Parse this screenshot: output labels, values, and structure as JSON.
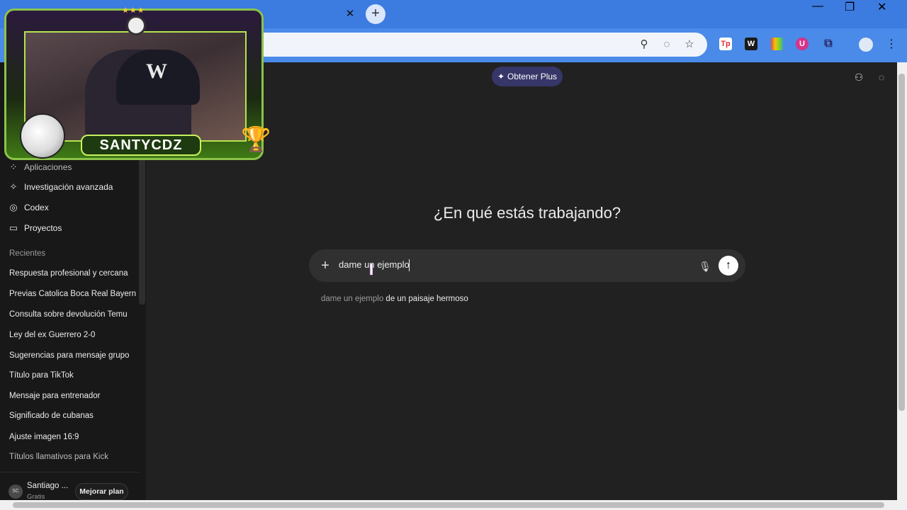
{
  "browser": {
    "window_controls": {
      "minimize": "—",
      "restore": "❐",
      "close": "✕"
    },
    "tab_close": "✕",
    "new_tab": "+",
    "omnibox_icons": [
      "zoom-icon",
      "eye-off-icon",
      "star-icon"
    ],
    "extensions": [
      {
        "name": "tp-extension-icon",
        "label": "Tp",
        "color": "#e0313a"
      },
      {
        "name": "w-extension-icon",
        "label": "W",
        "color": "#1a1a1a"
      },
      {
        "name": "color-extension-icon",
        "label": "",
        "color": "#7ed321"
      },
      {
        "name": "u-extension-icon",
        "label": "U",
        "color": "#d6338a"
      },
      {
        "name": "puzzle-extension-icon",
        "label": "",
        "color": "#2a5bd7"
      }
    ]
  },
  "sidebar": {
    "nav": [
      {
        "icon": "apps-icon",
        "glyph": "⁘",
        "label": "Aplicaciones"
      },
      {
        "icon": "telescope-icon",
        "glyph": "✧",
        "label": "Investigación avanzada"
      },
      {
        "icon": "codex-icon",
        "glyph": "◎",
        "label": "Codex"
      },
      {
        "icon": "folder-icon",
        "glyph": "▭",
        "label": "Proyectos"
      }
    ],
    "recent_title": "Recientes",
    "recent": [
      "Respuesta profesional y cercana",
      "Previas Catolica Boca Real Bayern",
      "Consulta sobre devolución Temu",
      "Ley del ex Guerrero 2-0",
      "Sugerencias para mensaje grupo",
      "Título para TikTok",
      "Mensaje para entrenador",
      "Significado de cubanas",
      "Ajuste imagen 16:9",
      "Títulos llamativos para Kick"
    ],
    "user": {
      "initials": "SC",
      "name": "Santiago ...",
      "plan": "Gratis",
      "upgrade": "Mejorar plan"
    }
  },
  "main": {
    "plus_button": "Obtener Plus",
    "plus_icon": "✦",
    "heading": "¿En qué estás trabajando?",
    "composer": {
      "attach": "+",
      "value": "dame un ejemplo",
      "mic": "🎙",
      "send": "↑"
    },
    "suggestion": {
      "typed": "dame un ejemplo",
      "rest": " de un paisaje hermoso"
    }
  },
  "overlay": {
    "streamer": "SANTYCDZ",
    "stars": "★★★",
    "cap_logo": "W",
    "trophy": "🏆"
  }
}
